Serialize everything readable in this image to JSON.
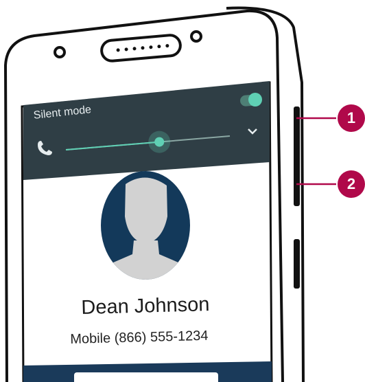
{
  "volume_panel": {
    "mode_label": "Silent mode",
    "toggle_on": true,
    "slider_level": 0.57,
    "phone_icon": "phone-icon",
    "expand_icon": "chevron-down-icon"
  },
  "contact": {
    "name": "Dean Johnson",
    "number": "Mobile (866) 555-1234",
    "avatar_icon": "person-silhouette-icon"
  },
  "callouts": [
    {
      "label": "1"
    },
    {
      "label": "2"
    }
  ],
  "colors": {
    "panel_bg": "#2f3e45",
    "accent": "#5fd0b4",
    "callout": "#b0094a",
    "avatar_bg": "#13395a",
    "action_bar": "#1a3a5a"
  }
}
